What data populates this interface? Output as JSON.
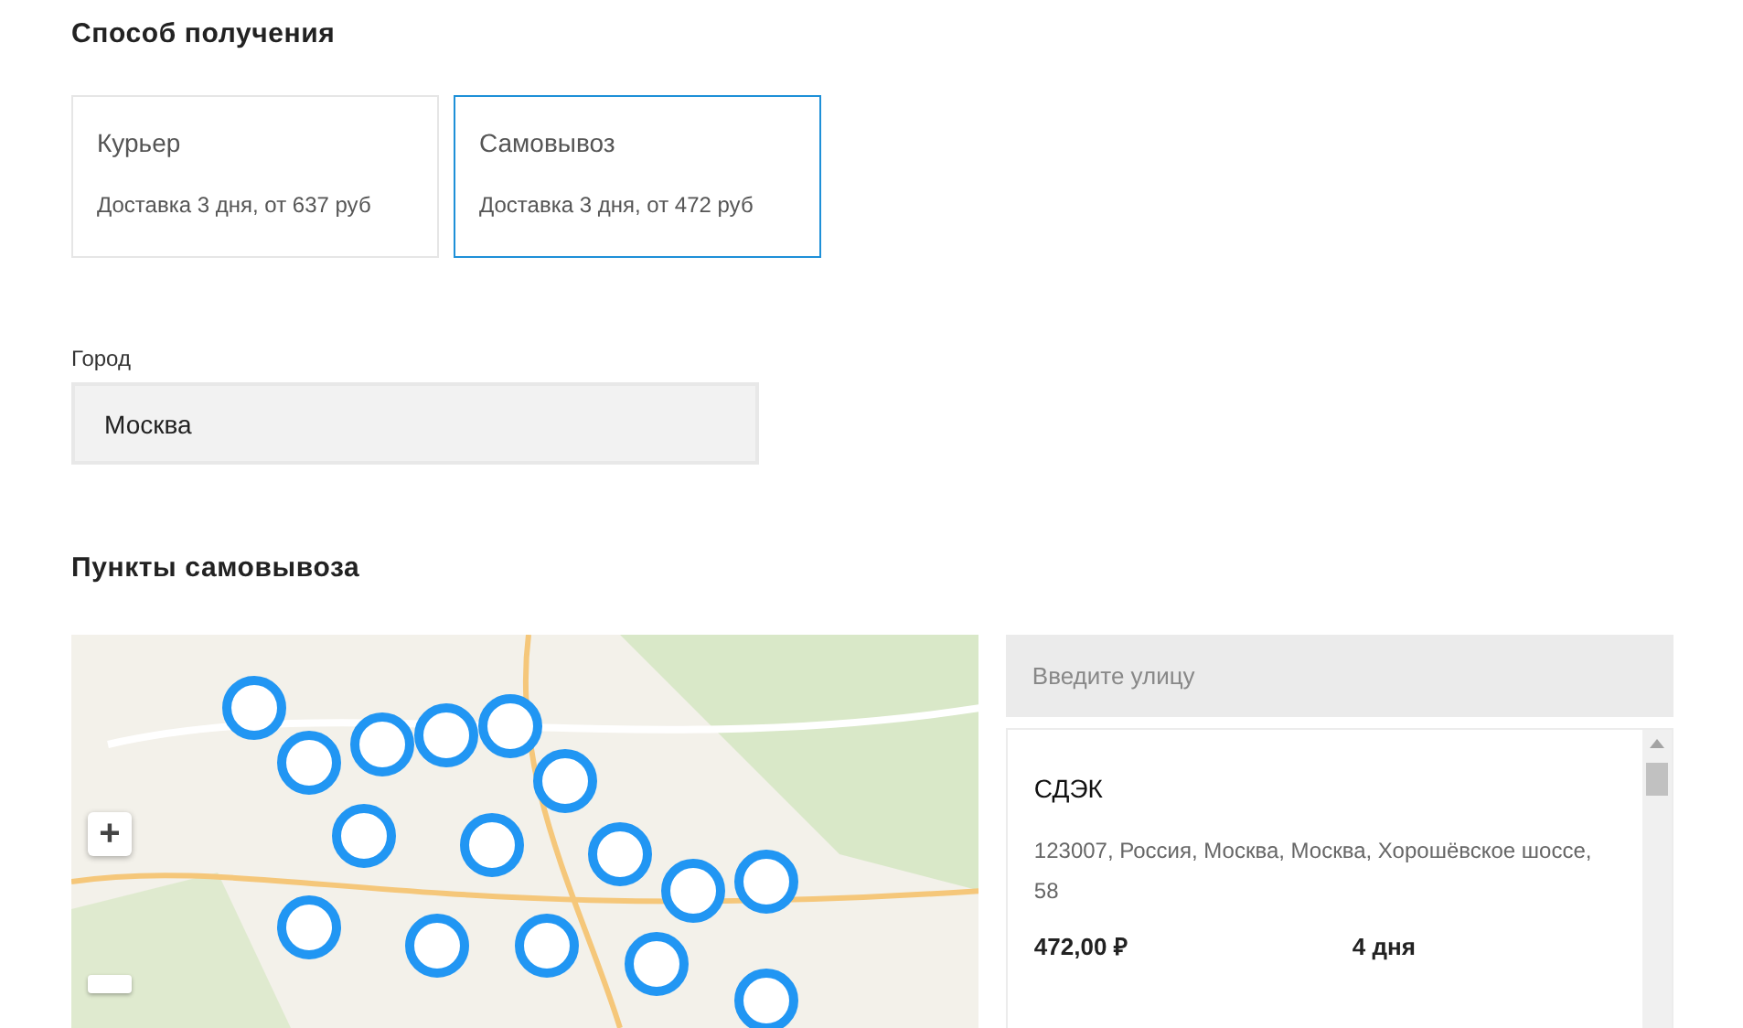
{
  "delivery_method": {
    "title": "Способ получения",
    "options": [
      {
        "title": "Курьер",
        "subtitle": "Доставка 3 дня, от 637 руб",
        "selected": false
      },
      {
        "title": "Самовывоз",
        "subtitle": "Доставка 3 дня, от 472 руб",
        "selected": true
      }
    ]
  },
  "city": {
    "label": "Город",
    "value": "Москва"
  },
  "pickup_points": {
    "title": "Пункты самовывоза",
    "map": {
      "kind": "picture",
      "zoom_in": "+"
    },
    "search": {
      "placeholder": "Введите улицу"
    },
    "points": [
      {
        "name": "СДЭК",
        "address": "123007, Россия, Москва, Москва, Хорошёвское шоссе, 58",
        "price": "472,00 ₽",
        "duration": "4 дня"
      }
    ]
  }
}
